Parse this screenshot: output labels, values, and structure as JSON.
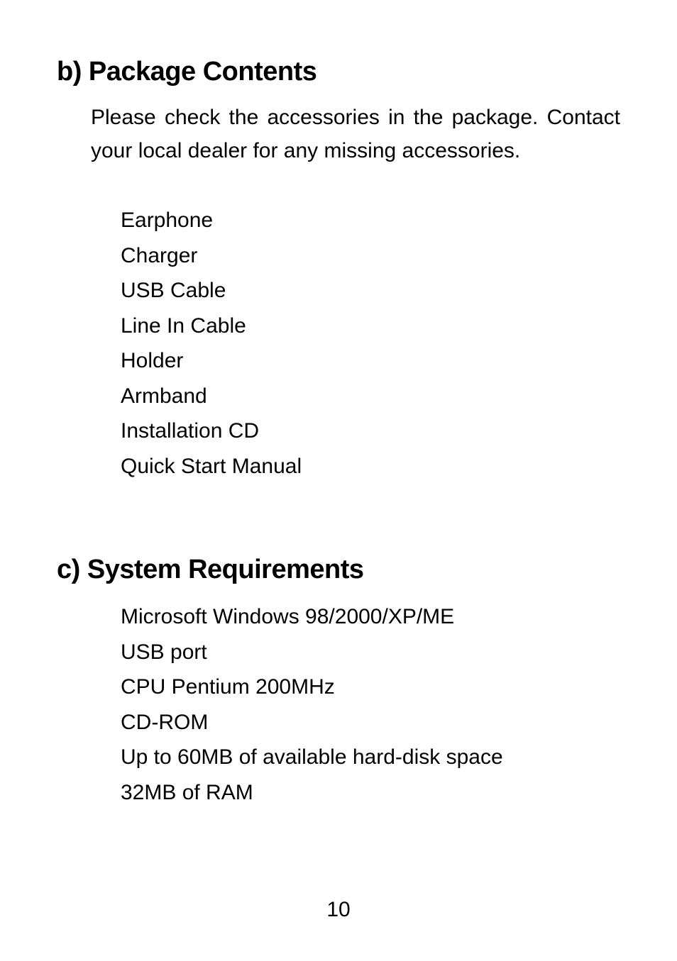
{
  "section_b": {
    "heading": "b) Package Contents",
    "intro": "Please check the accessories in the package. Contact your local dealer for any missing accessories.",
    "items": [
      "Earphone",
      "Charger",
      "USB Cable",
      "Line In Cable",
      "Holder",
      "Armband",
      "Installation CD",
      "Quick Start Manual"
    ]
  },
  "section_c": {
    "heading": "c) System Requirements",
    "items": [
      "Microsoft Windows 98/2000/XP/ME",
      "USB port",
      "CPU Pentium 200MHz",
      "CD-ROM",
      "Up to 60MB of available hard-disk space",
      "32MB of RAM"
    ]
  },
  "page_number": "10"
}
